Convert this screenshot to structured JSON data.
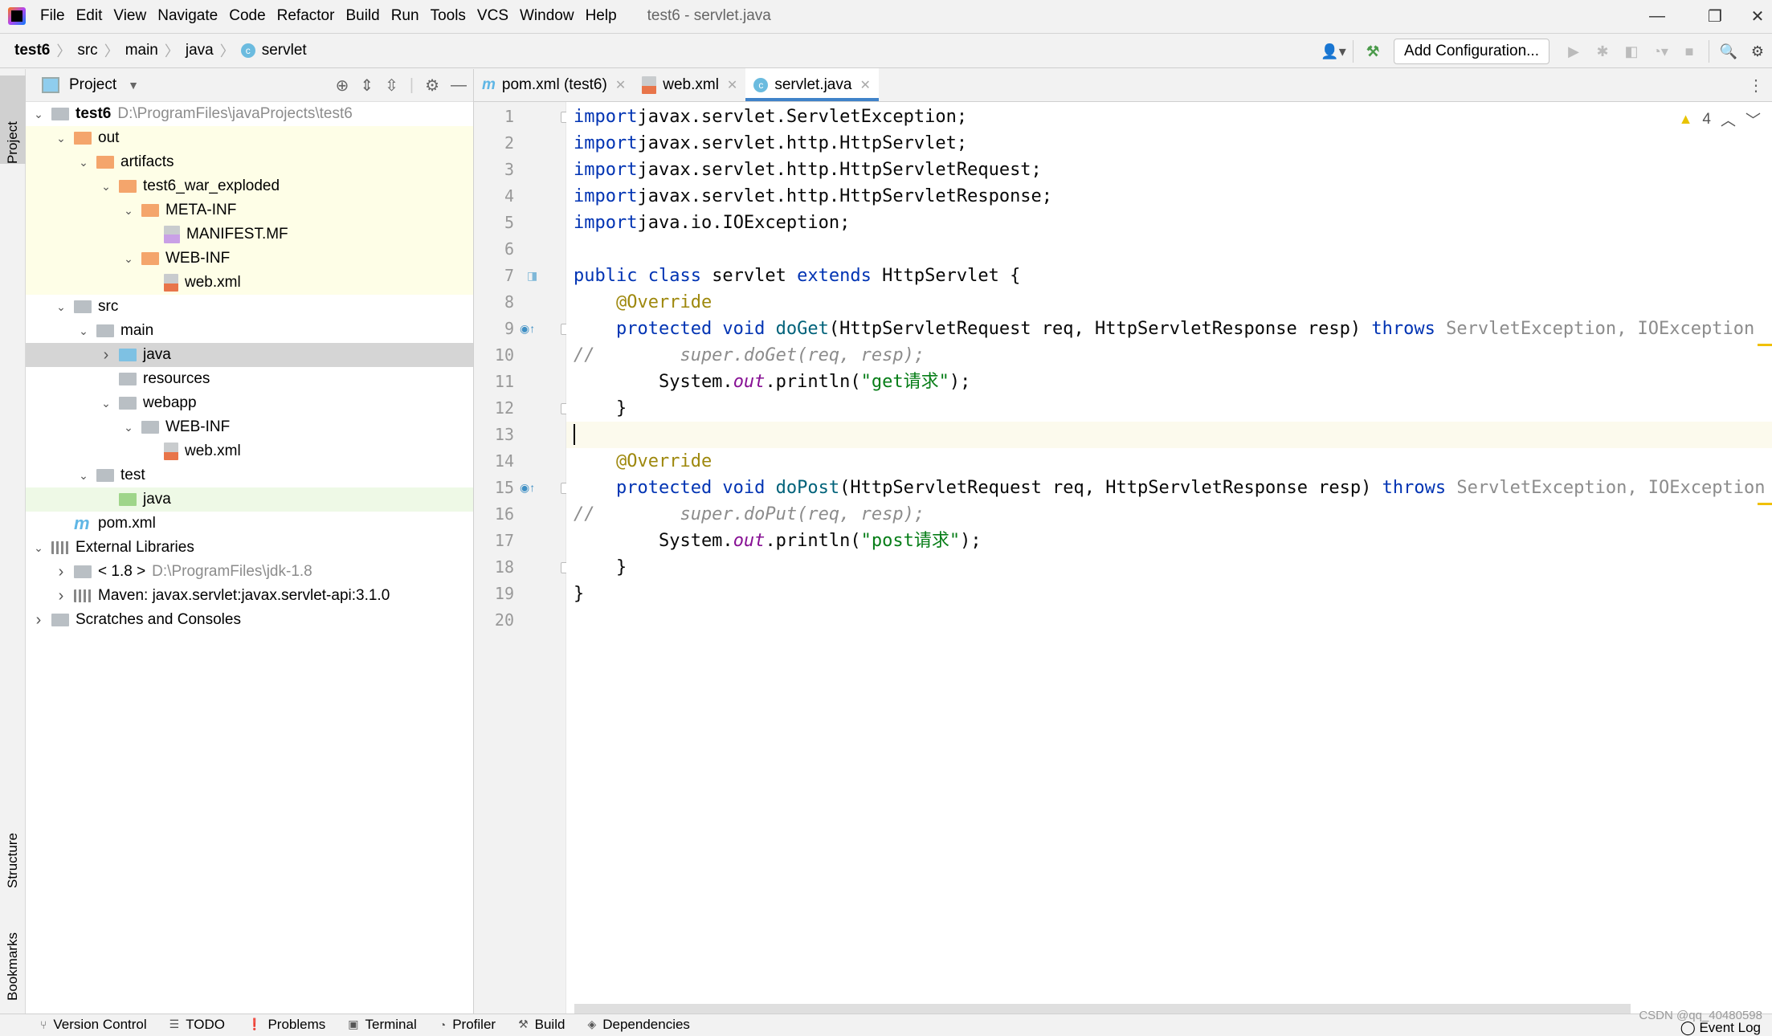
{
  "menubar": {
    "items": [
      "File",
      "Edit",
      "View",
      "Navigate",
      "Code",
      "Refactor",
      "Build",
      "Run",
      "Tools",
      "VCS",
      "Window",
      "Help"
    ],
    "window_title": "test6 - servlet.java",
    "controls": {
      "minimize": "—",
      "restore": "❐",
      "close": "✕"
    }
  },
  "navbar": {
    "breadcrumbs": [
      "test6",
      "src",
      "main",
      "java",
      "servlet"
    ],
    "class_icon": "c",
    "add_configuration": "Add Configuration...",
    "icons": [
      "user-icon",
      "build-hammer-icon",
      "run-icon",
      "debug-icon",
      "coverage-icon",
      "profile-icon",
      "stop-icon",
      "search-icon",
      "settings-icon"
    ]
  },
  "left_stripe": {
    "project": "Project",
    "structure": "Structure",
    "bookmarks": "Bookmarks"
  },
  "project_panel": {
    "title": "Project",
    "tree": [
      {
        "label": "test6",
        "hint": "D:\\ProgramFiles\\javaProjects\\test6",
        "depth": 0,
        "expanded": true,
        "icon": "module",
        "bold": true,
        "bg": "white"
      },
      {
        "label": "out",
        "depth": 1,
        "expanded": true,
        "icon": "orange",
        "bg": "yellow"
      },
      {
        "label": "artifacts",
        "depth": 2,
        "expanded": true,
        "icon": "orange",
        "bg": "yellow"
      },
      {
        "label": "test6_war_exploded",
        "depth": 3,
        "expanded": true,
        "icon": "orange",
        "bg": "yellow"
      },
      {
        "label": "META-INF",
        "depth": 4,
        "expanded": true,
        "icon": "orange",
        "bg": "yellow"
      },
      {
        "label": "MANIFEST.MF",
        "depth": 5,
        "icon": "mf",
        "bg": "yellow"
      },
      {
        "label": "WEB-INF",
        "depth": 4,
        "expanded": true,
        "icon": "orange",
        "bg": "yellow"
      },
      {
        "label": "web.xml",
        "depth": 5,
        "icon": "xml",
        "bg": "yellow"
      },
      {
        "label": "src",
        "depth": 1,
        "expanded": true,
        "icon": "gray",
        "bg": "white"
      },
      {
        "label": "main",
        "depth": 2,
        "expanded": true,
        "icon": "gray",
        "bg": "white"
      },
      {
        "label": "java",
        "depth": 3,
        "expanded": false,
        "icon": "blue",
        "bg": "selected"
      },
      {
        "label": "resources",
        "depth": 3,
        "icon": "gray",
        "bg": "white"
      },
      {
        "label": "webapp",
        "depth": 3,
        "expanded": true,
        "icon": "gray",
        "bg": "white"
      },
      {
        "label": "WEB-INF",
        "depth": 4,
        "expanded": true,
        "icon": "gray",
        "bg": "white"
      },
      {
        "label": "web.xml",
        "depth": 5,
        "icon": "xml",
        "bg": "white"
      },
      {
        "label": "test",
        "depth": 2,
        "expanded": true,
        "icon": "gray",
        "bg": "white"
      },
      {
        "label": "java",
        "depth": 3,
        "icon": "green",
        "bg": "green"
      },
      {
        "label": "pom.xml",
        "depth": 1,
        "icon": "maven",
        "bg": "white"
      },
      {
        "label": "External Libraries",
        "depth": 0,
        "expanded": true,
        "icon": "lib",
        "bg": "white"
      },
      {
        "label": "< 1.8 >",
        "hint": "D:\\ProgramFiles\\jdk-1.8",
        "depth": 1,
        "expanded": false,
        "icon": "gray",
        "bg": "white"
      },
      {
        "label": "Maven: javax.servlet:javax.servlet-api:3.1.0",
        "depth": 1,
        "expanded": false,
        "icon": "lib",
        "bg": "white"
      },
      {
        "label": "Scratches and Consoles",
        "depth": 0,
        "expanded": false,
        "icon": "gray",
        "bg": "white"
      }
    ]
  },
  "editor": {
    "tabs": [
      {
        "label": "pom.xml (test6)",
        "icon": "maven",
        "active": false
      },
      {
        "label": "web.xml",
        "icon": "xml",
        "active": false
      },
      {
        "label": "servlet.java",
        "icon": "class",
        "active": true
      }
    ],
    "warnings_count": "4",
    "current_line": 13,
    "lines": [
      [
        [
          "kw",
          "import"
        ],
        [
          "",
          "javax.servlet.ServletException;"
        ]
      ],
      [
        [
          "kw",
          "import"
        ],
        [
          "",
          "javax.servlet.http.HttpServlet;"
        ]
      ],
      [
        [
          "kw",
          "import"
        ],
        [
          "",
          "javax.servlet.http.HttpServletRequest;"
        ]
      ],
      [
        [
          "kw",
          "import"
        ],
        [
          "",
          "javax.servlet.http.HttpServletResponse;"
        ]
      ],
      [
        [
          "kw",
          "import"
        ],
        [
          "",
          "java.io.IOException;"
        ]
      ],
      [],
      [
        [
          "kw",
          "public class "
        ],
        [
          "",
          "servlet "
        ],
        [
          "kw",
          "extends "
        ],
        [
          "",
          "HttpServlet {"
        ]
      ],
      [
        [
          "",
          "    "
        ],
        [
          "ann",
          "@Override"
        ]
      ],
      [
        [
          "",
          "    "
        ],
        [
          "kw",
          "protected void "
        ],
        [
          "mth",
          "doGet"
        ],
        [
          "",
          "(HttpServletRequest req, HttpServletResponse resp) "
        ],
        [
          "kw",
          "throws "
        ],
        [
          "gr",
          "ServletException, IOException"
        ]
      ],
      [
        [
          "cmt",
          "//        super.doGet(req, resp);"
        ]
      ],
      [
        [
          "",
          "        System."
        ],
        [
          "fld",
          "out"
        ],
        [
          "",
          ".println("
        ],
        [
          "str",
          "\"get请求\""
        ],
        [
          "",
          ");"
        ]
      ],
      [
        [
          "",
          "    }"
        ]
      ],
      [],
      [
        [
          "",
          "    "
        ],
        [
          "ann",
          "@Override"
        ]
      ],
      [
        [
          "",
          "    "
        ],
        [
          "kw",
          "protected void "
        ],
        [
          "mth",
          "doPost"
        ],
        [
          "",
          "(HttpServletRequest req, HttpServletResponse resp) "
        ],
        [
          "kw",
          "throws "
        ],
        [
          "gr",
          "ServletException, IOException"
        ]
      ],
      [
        [
          "cmt",
          "//        super.doPut(req, resp);"
        ]
      ],
      [
        [
          "",
          "        System."
        ],
        [
          "fld",
          "out"
        ],
        [
          "",
          ".println("
        ],
        [
          "str",
          "\"post请求\""
        ],
        [
          "",
          ");"
        ]
      ],
      [
        [
          "",
          "    }"
        ]
      ],
      [
        [
          "",
          "}"
        ]
      ],
      []
    ]
  },
  "bottom_bar": {
    "items": [
      "Version Control",
      "TODO",
      "Problems",
      "Terminal",
      "Profiler",
      "Build",
      "Dependencies"
    ],
    "event_log": "Event Log",
    "watermark": "CSDN @qq_40480598"
  }
}
